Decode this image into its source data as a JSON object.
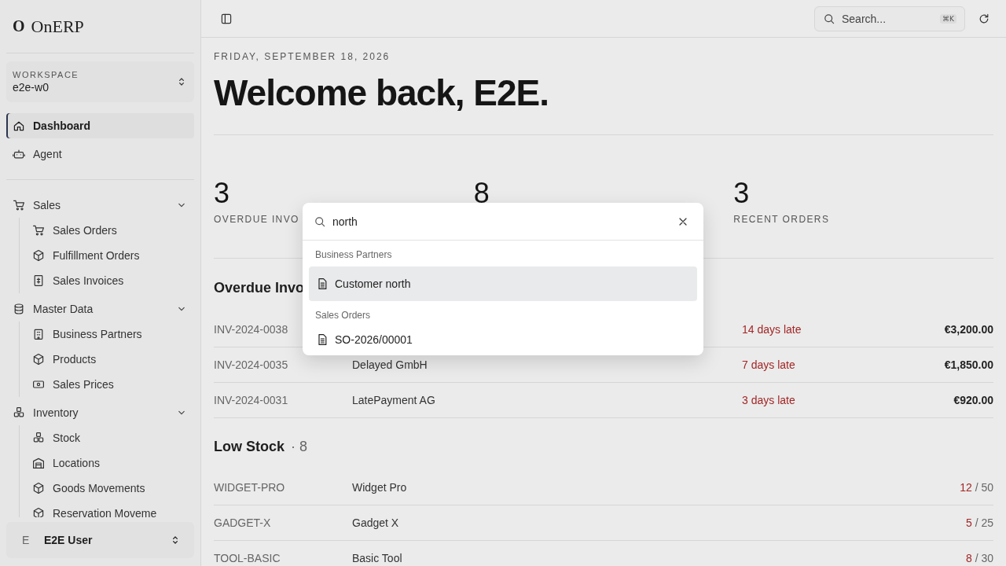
{
  "sidebar": {
    "logo": "O",
    "brand": "OnERP",
    "workspace": {
      "label": "WORKSPACE",
      "value": "e2e-w0"
    },
    "items": [
      {
        "label": "Dashboard",
        "selected": true
      },
      {
        "label": "Agent",
        "selected": false
      }
    ],
    "groups": [
      {
        "label": "Sales",
        "expanded": true,
        "children": [
          {
            "label": "Sales Orders",
            "selected": false
          },
          {
            "label": "Fulfillment Orders",
            "selected": false
          },
          {
            "label": "Sales Invoices",
            "selected": false
          }
        ]
      },
      {
        "label": "Master Data",
        "expanded": true,
        "children": [
          {
            "label": "Business Partners",
            "selected": false
          },
          {
            "label": "Products",
            "selected": false
          },
          {
            "label": "Sales Prices",
            "selected": false
          }
        ]
      },
      {
        "label": "Inventory",
        "expanded": true,
        "children": [
          {
            "label": "Stock",
            "selected": false
          },
          {
            "label": "Locations",
            "selected": false
          },
          {
            "label": "Goods Movements",
            "selected": false
          },
          {
            "label": "Reservation Moveme",
            "selected": false
          }
        ]
      }
    ],
    "user": {
      "initial": "E",
      "name": "E2E User"
    }
  },
  "topbar": {
    "search": {
      "placeholder": "Search...",
      "shortcut": "⌘K"
    }
  },
  "date": "FRIDAY, SEPTEMBER 18, 2026",
  "heading": "Welcome back, E2E.",
  "stats": [
    {
      "value": "3",
      "label": "OVERDUE INVO"
    },
    {
      "value": "8"
    },
    {
      "value": "3",
      "label": "RECENT ORDERS"
    }
  ],
  "overdue": {
    "title": "Overdue Invo",
    "rows": [
      {
        "number": "INV-2024-0038",
        "status": "14 days late",
        "amount": "€3,200.00"
      },
      {
        "number": "INV-2024-0035",
        "customer": "Delayed GmbH",
        "status": "7 days late",
        "amount": "€1,850.00"
      },
      {
        "number": "INV-2024-0031",
        "customer": "LatePayment AG",
        "status": "3 days late",
        "amount": "€920.00"
      }
    ]
  },
  "low_stock": {
    "title": "Low Stock",
    "count": "· 8",
    "rows": [
      {
        "sku": "WIDGET-PRO",
        "name": "Widget Pro",
        "qty": "12",
        "min": "/ 50"
      },
      {
        "sku": "GADGET-X",
        "name": "Gadget X",
        "qty": "5",
        "min": "/ 25"
      },
      {
        "sku": "TOOL-BASIC",
        "name": "Basic Tool",
        "qty": "8",
        "min": "/ 30"
      }
    ]
  },
  "palette": {
    "query": "north",
    "groups": [
      {
        "label": "Business Partners",
        "items": [
          {
            "label": "Customer north",
            "selected": true
          }
        ]
      },
      {
        "label": "Sales Orders",
        "items": [
          {
            "label": "SO-2026/00001",
            "selected": false
          }
        ]
      }
    ]
  }
}
